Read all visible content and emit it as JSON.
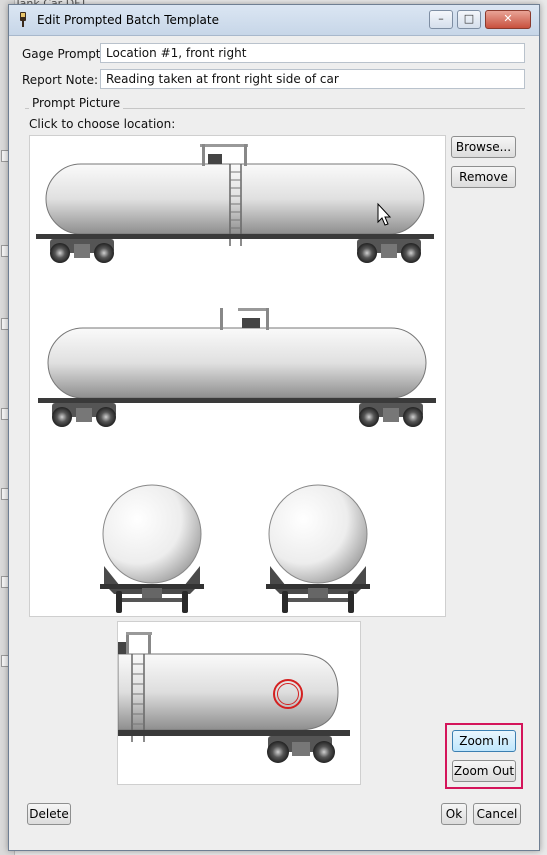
{
  "background": {
    "top_text": "er Tank Car DFT"
  },
  "dialog": {
    "title": "Edit Prompted Batch Template",
    "window_buttons": {
      "minimize": "–",
      "maximize": "□",
      "close": "✕"
    }
  },
  "form": {
    "gage_prompt_label": "Gage Prompt:",
    "gage_prompt_value": "Location #1, front right",
    "report_note_label": "Report Note:",
    "report_note_value": "Reading taken at front right side of car"
  },
  "prompt_picture": {
    "group_title": "Prompt Picture",
    "instruction": "Click to choose location:",
    "browse_label": "Browse...",
    "remove_label": "Remove",
    "zoom_in_label": "Zoom In",
    "zoom_out_label": "Zoom Out"
  },
  "footer": {
    "delete_label": "Delete",
    "ok_label": "Ok",
    "cancel_label": "Cancel"
  },
  "colors": {
    "highlight": "#d4145a",
    "marker": "#d42020",
    "titlebar": "#c7d6e8"
  },
  "icons": {
    "app": "gauge-icon",
    "cursor": "mouse-pointer-icon",
    "location_marker": "selected-location-circle"
  }
}
